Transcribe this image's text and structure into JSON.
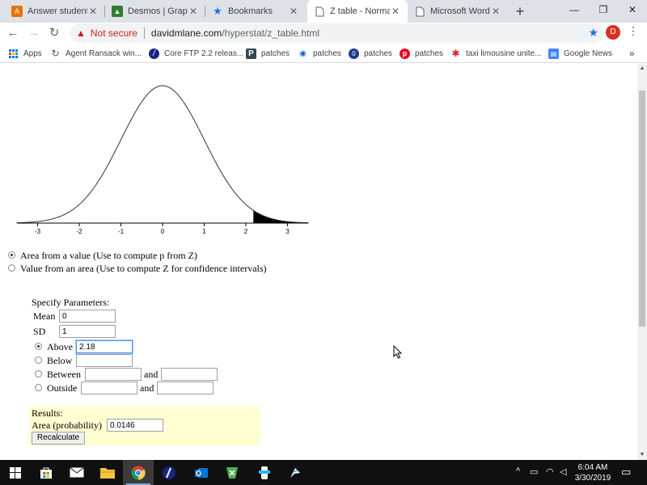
{
  "tabs": [
    {
      "title": "Answer students'",
      "icon": "answer-students-icon",
      "active": false
    },
    {
      "title": "Desmos | Graphin",
      "icon": "desmos-icon",
      "active": false
    },
    {
      "title": "Bookmarks",
      "icon": "bookmark-star-icon",
      "active": false
    },
    {
      "title": "Z table - Normal l",
      "icon": "page-icon",
      "active": true
    },
    {
      "title": "Microsoft Word -",
      "icon": "page-icon",
      "active": false
    }
  ],
  "address": {
    "security": "Not secure",
    "host": "davidmlane.com",
    "path": "/hyperstat/z_table.html"
  },
  "profile_initial": "D",
  "bookmarks": [
    {
      "label": "Apps",
      "icon": "apps-grid-icon"
    },
    {
      "label": "Agent Ransack win...",
      "icon": "refresh-circle-icon"
    },
    {
      "label": "Core FTP 2.2 releas...",
      "icon": "coreftp-icon"
    },
    {
      "label": "patches",
      "icon": "p-square-icon"
    },
    {
      "label": "patches",
      "icon": "drop-icon"
    },
    {
      "label": "patches",
      "icon": "o-circle-icon"
    },
    {
      "label": "patches",
      "icon": "pinterest-icon"
    },
    {
      "label": "taxi limousine unite...",
      "icon": "yelp-icon"
    },
    {
      "label": "Google News",
      "icon": "google-news-icon"
    }
  ],
  "more_bookmarks": "»",
  "chart_data": {
    "type": "line",
    "title": "",
    "xlabel": "",
    "ylabel": "",
    "x_ticks": [
      "-3",
      "-2",
      "-1",
      "0",
      "1",
      "2",
      "3"
    ],
    "xlim": [
      -3.5,
      3.5
    ],
    "series": [
      {
        "function": "standard normal density",
        "mean": 0,
        "sd": 1
      }
    ],
    "shaded_region": {
      "from": 2.18,
      "to": 3.5,
      "side": "above"
    }
  },
  "mode": {
    "options": [
      {
        "label": "Area from a value (Use to compute p from Z)",
        "checked": true
      },
      {
        "label": "Value from an area (Use to compute Z for confidence intervals)",
        "checked": false
      }
    ]
  },
  "params": {
    "heading": "Specify Parameters:",
    "mean_label": "Mean",
    "mean_value": "0",
    "sd_label": "SD",
    "sd_value": "1",
    "above_label": "Above",
    "above_value": "2.18",
    "below_label": "Below",
    "below_value": "",
    "between_label": "Between",
    "outside_label": "Outside",
    "and_label": "and",
    "selected": "Above"
  },
  "results": {
    "heading": "Results:",
    "area_label": "Area (probability)",
    "area_value": "0.0146",
    "button": "Recalculate"
  },
  "taskbar": {
    "apps": [
      "start-windows-icon",
      "store-icon",
      "mail-icon",
      "file-explorer-icon",
      "chrome-icon",
      "coreftp-taskbar-icon",
      "outlook-icon",
      "app-icon-1",
      "app-icon-2",
      "app-icon-3"
    ],
    "time": "6:04 AM",
    "date": "3/30/2019"
  },
  "window_controls": {
    "minimize": "—",
    "restore": "❐",
    "close": "✕"
  }
}
